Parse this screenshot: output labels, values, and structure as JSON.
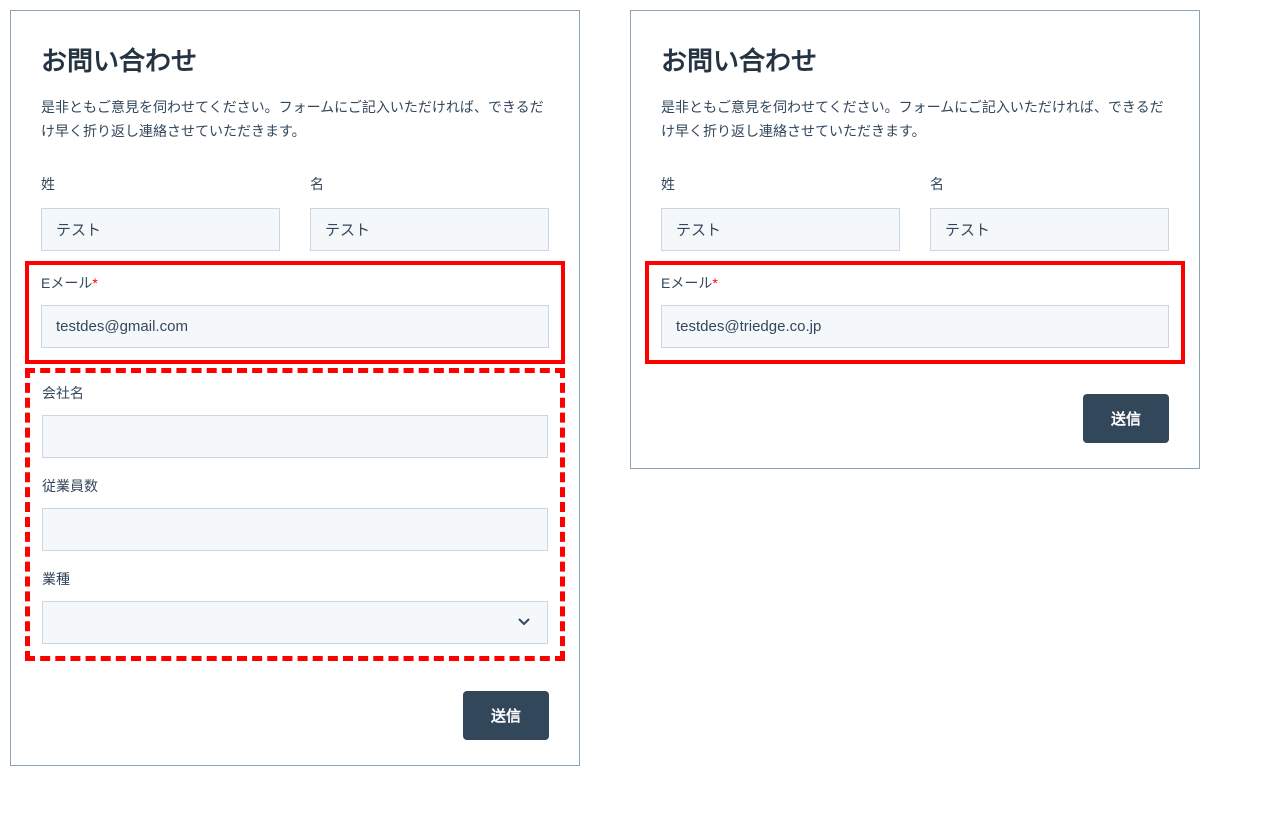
{
  "form1": {
    "title": "お問い合わせ",
    "description": "是非ともご意見を伺わせてください。フォームにご記入いただければ、できるだけ早く折り返し連絡させていただきます。",
    "labels": {
      "lastname": "姓",
      "firstname": "名",
      "email": "Eメール",
      "required_mark": "*",
      "company": "会社名",
      "employees": "従業員数",
      "industry": "業種"
    },
    "values": {
      "lastname": "テスト",
      "firstname": "テスト",
      "email": "testdes@gmail.com",
      "company": "",
      "employees": "",
      "industry": ""
    },
    "submit_label": "送信"
  },
  "form2": {
    "title": "お問い合わせ",
    "description": "是非ともご意見を伺わせてください。フォームにご記入いただければ、できるだけ早く折り返し連絡させていただきます。",
    "labels": {
      "lastname": "姓",
      "firstname": "名",
      "email": "Eメール",
      "required_mark": "*"
    },
    "values": {
      "lastname": "テスト",
      "firstname": "テスト",
      "email": "testdes@triedge.co.jp"
    },
    "submit_label": "送信"
  }
}
